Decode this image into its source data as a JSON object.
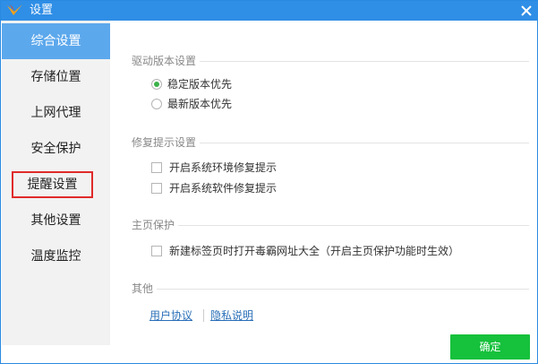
{
  "window": {
    "title": "设置",
    "accent_color": "#2f8ee6",
    "close_icon": "close-icon"
  },
  "sidebar": {
    "items": [
      {
        "label": "综合设置",
        "active": true
      },
      {
        "label": "存储位置"
      },
      {
        "label": "上网代理"
      },
      {
        "label": "安全保护"
      },
      {
        "label": "提醒设置",
        "highlighted": true
      },
      {
        "label": "其他设置"
      },
      {
        "label": "温度监控"
      }
    ]
  },
  "sections": {
    "driver": {
      "title": "驱动版本设置",
      "options": [
        {
          "label": "稳定版本优先",
          "selected": true
        },
        {
          "label": "最新版本优先",
          "selected": false
        }
      ]
    },
    "repair": {
      "title": "修复提示设置",
      "options": [
        {
          "label": "开启系统环境修复提示",
          "checked": false
        },
        {
          "label": "开启系统软件修复提示",
          "checked": false
        }
      ]
    },
    "homepage": {
      "title": "主页保护",
      "options": [
        {
          "label": "新建标签页时打开毒霸网址大全（开启主页保护功能时生效）",
          "checked": false
        }
      ]
    },
    "other": {
      "title": "其他",
      "links": [
        {
          "label": "用户协议"
        },
        {
          "label": "隐私说明"
        }
      ]
    }
  },
  "footer": {
    "ok_label": "确定",
    "ok_color": "#16c13c"
  }
}
